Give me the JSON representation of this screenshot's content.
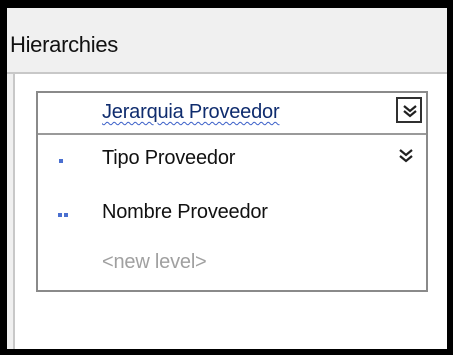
{
  "pane": {
    "title": "Hierarchies"
  },
  "hierarchy": {
    "name": "Jerarquia Proveedor",
    "collapse_icon": "double-chevron-up-icon",
    "levels": [
      {
        "label": "Tipo Proveedor",
        "icon": "single-attribute-level-icon"
      },
      {
        "label": "Nombre Proveedor",
        "icon": "double-attribute-level-icon"
      }
    ],
    "new_level_label": "<new level>",
    "expand_icon": "double-chevron-down-icon"
  },
  "colors": {
    "name_text": "#0f2c6e",
    "level_icon": "#4a6fd0",
    "placeholder_text": "#a0a0a0"
  }
}
